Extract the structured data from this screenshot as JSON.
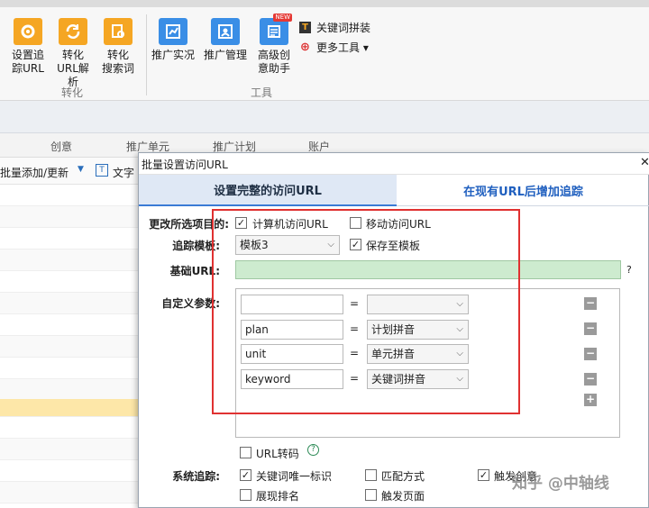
{
  "ribbon": {
    "buttons": [
      {
        "label": "设置追\n踪URL"
      },
      {
        "label": "转化\nURL解析"
      },
      {
        "label": "转化\n搜索词"
      },
      {
        "label": "推广实况"
      },
      {
        "label": "推广管理"
      },
      {
        "label": "高级创\n意助手"
      }
    ],
    "new_badge": "NEW",
    "small_items": [
      {
        "label": "关键词拼装",
        "icon": "T"
      },
      {
        "label": "更多工具 ▾",
        "icon": "⊕"
      }
    ],
    "groups": [
      "转化",
      "工具"
    ]
  },
  "columns": [
    "创意",
    "推广单元",
    "推广计划",
    "账户"
  ],
  "bg_toolbar": {
    "batch_add": "批量添加/更新",
    "text_button": "文字"
  },
  "dialog": {
    "title": "批量设置访问URL",
    "close": "✕",
    "tabs": [
      "设置完整的访问URL",
      "在现有URL后增加追踪"
    ],
    "change_label": "更改所选项目的:",
    "pc_url": "计算机访问URL",
    "mobile_url": "移动访问URL",
    "template_label": "追踪模板:",
    "template_value": "模板3",
    "save_template": "保存至模板",
    "base_url_label": "基础URL:",
    "help": "?",
    "custom_label": "自定义参数:",
    "eq": "=",
    "params": [
      {
        "name": "",
        "value": ""
      },
      {
        "name": "plan",
        "value": "计划拼音"
      },
      {
        "name": "unit",
        "value": "单元拼音"
      },
      {
        "name": "keyword",
        "value": "关键词拼音"
      }
    ],
    "url_transcode": "URL转码",
    "sys_track_label": "系统追踪:",
    "sys_options": [
      "关键词唯一标识",
      "匹配方式",
      "触发创意",
      "展现排名",
      "触发页面"
    ]
  },
  "watermark": "知乎 @中轴线"
}
